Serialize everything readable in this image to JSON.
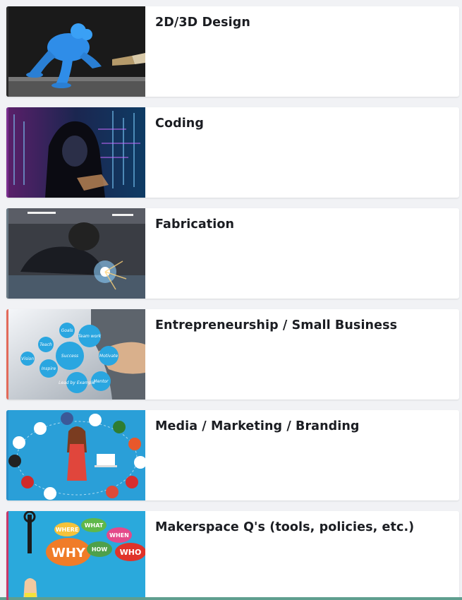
{
  "boards": [
    {
      "title": "2D/3D Design",
      "accent": "#2b2b2b",
      "icon": "frog-3d-print-image"
    },
    {
      "title": "Coding",
      "accent": "#7a2f8f",
      "icon": "hooded-coder-image"
    },
    {
      "title": "Fabrication",
      "accent": "#6a7a86",
      "icon": "welding-image"
    },
    {
      "title": "Entrepreneurship / Small Business",
      "accent": "#e36a5a",
      "icon": "business-bubbles-image"
    },
    {
      "title": "Media / Marketing / Branding",
      "accent": "#2a8fc9",
      "icon": "social-media-image"
    },
    {
      "title": "Makerspace Q's (tools, policies, etc.)",
      "accent": "#c7386a",
      "icon": "questions-image"
    }
  ],
  "thumb_text": {
    "business": [
      "Goals",
      "Team work",
      "Teach",
      "Success",
      "Motivate",
      "Vision",
      "Inspire",
      "Lead by Example",
      "Mentor"
    ],
    "questions": [
      "WHERE",
      "WHAT",
      "WHEN",
      "WHY",
      "HOW",
      "WHO"
    ]
  }
}
